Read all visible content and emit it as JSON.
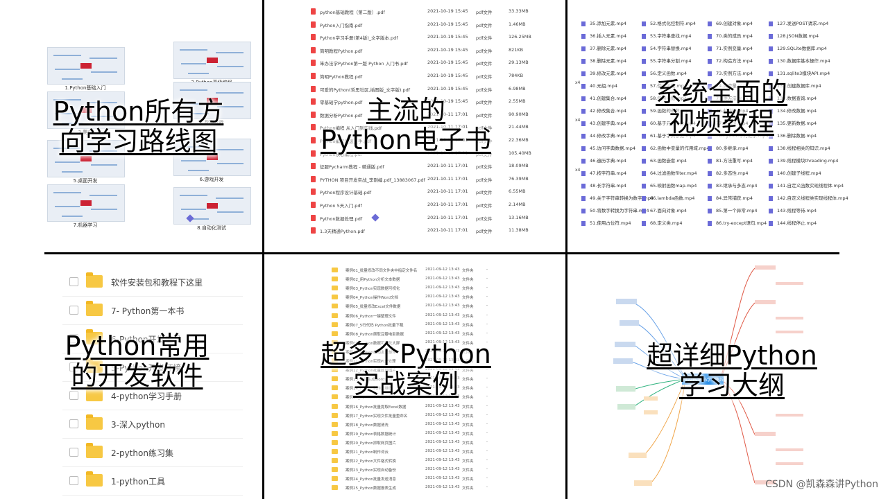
{
  "panels": {
    "roadmap": {
      "title": "Python所有方\n向学习路线图",
      "thumbs": [
        "1.Python基础入门",
        "2.Python高级编程",
        "3.爬虫",
        "4.数据分析",
        "5.桌面开发",
        "6.游戏开发",
        "7.机器学习",
        "8.自动化测试"
      ]
    },
    "ebooks": {
      "title": "主流的\nPython电子书",
      "files": [
        {
          "name": "python基础教程（第二版）.pdf",
          "date": "2021-10-19 15:45",
          "type": "pdf文件",
          "size": "33.33MB"
        },
        {
          "name": "Python入门指南.pdf",
          "date": "2021-10-19 15:45",
          "type": "pdf文件",
          "size": "1.46MB"
        },
        {
          "name": "Python学习手册(第4版)_文字版本.pdf",
          "date": "2021-10-19 15:45",
          "type": "pdf文件",
          "size": "126.25MB"
        },
        {
          "name": "简明教程Python.pdf",
          "date": "2021-10-19 15:45",
          "type": "pdf文件",
          "size": "821KB"
        },
        {
          "name": "笨办法学Python第一版 Python 入门书.pdf",
          "date": "2021-10-19 15:45",
          "type": "pdf文件",
          "size": "29.13MB"
        },
        {
          "name": "简明Python教程.pdf",
          "date": "2021-10-19 15:45",
          "type": "pdf文件",
          "size": "784KB"
        },
        {
          "name": "可爱的Python(哲思社区,插图版_文字版).pdf",
          "date": "2021-10-19 15:45",
          "type": "pdf文件",
          "size": "6.98MB"
        },
        {
          "name": "零基础学python.pdf",
          "date": "2021-10-19 15:45",
          "type": "pdf文件",
          "size": "2.55MB"
        },
        {
          "name": "数据分析Python.pdf",
          "date": "2021-10-11 17:01",
          "type": "pdf文件",
          "size": "90.90MB"
        },
        {
          "name": "Python编程 从入门到实践.pdf",
          "date": "2021-10-11 17:01",
          "type": "pdf文件",
          "size": "21.44MB"
        },
        {
          "name": "Python编程快速上手.pdf",
          "date": "2021-10-11 17:01",
          "type": "pdf文件",
          "size": "22.36MB"
        },
        {
          "name": "Python核心编程.pdf",
          "date": "2021-10-11 17:01",
          "type": "pdf文件",
          "size": "105.40MB"
        },
        {
          "name": "征服Pycharm教程 - 精通版.pdf",
          "date": "2021-10-11 17:01",
          "type": "pdf文件",
          "size": "18.09MB"
        },
        {
          "name": "PYTHON 项目开发实战_李刚编.pdf_13883067.pdf",
          "date": "2021-10-11 17:01",
          "type": "pdf文件",
          "size": "76.39MB"
        },
        {
          "name": "Python程序设计基础.pdf",
          "date": "2021-10-11 17:01",
          "type": "pdf文件",
          "size": "6.55MB"
        },
        {
          "name": "Python 5天入门.pdf",
          "date": "2021-10-11 17:01",
          "type": "pdf文件",
          "size": "2.14MB"
        },
        {
          "name": "Python数据处理.pdf",
          "date": "2021-10-11 17:01",
          "type": "pdf文件",
          "size": "13.16MB"
        },
        {
          "name": "1.3天精通Python.pdf",
          "date": "2021-10-11 17:01",
          "type": "pdf文件",
          "size": "11.38MB"
        }
      ]
    },
    "videos": {
      "title": "系统全面的\n视频教程",
      "markers": [
        "x4",
        "x4",
        "x4"
      ],
      "columns": [
        [
          "35.添加元素.mp4",
          "36.插入元素.mp4",
          "37.删除元素.mp4",
          "38.删除元素.mp4",
          "39.修改元素.mp4",
          "40.元组.mp4",
          "41.创建集合.mp4",
          "42.修改集合.mp4",
          "43.创建字典.mp4",
          "44.修改字典.mp4",
          "45.访问字典数据.mp4",
          "46.遍历字典.mp4",
          "47.按字符串.mp4",
          "48.长字符串.mp4",
          "49.关于字符串转换为数字.mp4",
          "50.将数字转换为字符串.mp4",
          "51.使用占位符.mp4"
        ],
        [
          "52.格式化控制符.mp4",
          "53.字符串查找.mp4",
          "54.字符串替换.mp4",
          "55.字符串分割.mp4",
          "56.定义函数.mp4",
          "57.使用函数.mp4",
          "58.使用函数.mp4",
          "59.函数的参数.mp4",
          "60.基于元组参数.mp4",
          "61.基于字典参数.mp4",
          "62.函数中变量的作用域.mp4",
          "63.函数嵌套.mp4",
          "64.过滤函数filter.mp4",
          "65.映射函数map.mp4",
          "66.lambda函数.mp4",
          "67.面向对象.mp4",
          "68.定义类.mp4"
        ],
        [
          "69.创建对象.mp4",
          "70.类的成员.mp4",
          "71.实例变量.mp4",
          "72.构造方法.mp4",
          "73.实例方法.mp4",
          "74.类变量.mp4",
          "75.类方法.mp4",
          "76.封装性.mp4",
          "77.继承性.mp4",
          "78.Python中的继承.mp4",
          "80.多继承.mp4",
          "81.方法重写.mp4",
          "82.多态性.mp4",
          "83.继承与多态.mp4",
          "84.异常捕获.mp4",
          "85.第一个异常.mp4",
          "86.try-except语句.mp4"
        ],
        [
          "127.发送POST请求.mp4",
          "128.JSON数据.mp4",
          "129.SQLite数据库.mp4",
          "130.数据库基本操作.mp4",
          "131.sqlite3模块API.mp4",
          "132.创建数据库.mp4",
          "133.数据查询.mp4",
          "134.修改数据.mp4",
          "135.更新数据.mp4",
          "136.删除数据.mp4",
          "138.线程相关的知识.mp4",
          "139.线程模块threading.mp4",
          "140.创建子线程.mp4",
          "141.自定义函数实现线程体.mp4",
          "142.自定义线程类实现线程体.mp4",
          "143.线程等待.mp4",
          "144.线程停止.mp4"
        ]
      ]
    },
    "software": {
      "title": "Python常用\n的开发软件",
      "folders": [
        "软件安装包和教程下这里",
        "7- Python第一本书",
        "6-Python开发工具",
        "5-Python开发环境",
        "4-python学习手册",
        "3-深入python",
        "2-python练习集",
        "1-python工具"
      ]
    },
    "cases": {
      "title": "超多个Python\n实战案例",
      "rows": [
        {
          "name": "案例01_批量修改不同文件夹中指定文件名",
          "date": "2021-09-12 13:43",
          "type": "文件夹",
          "extra": "-"
        },
        {
          "name": "案例02_用Python分析文本数据",
          "date": "2021-09-12 13:43",
          "type": "文件夹",
          "extra": "-"
        },
        {
          "name": "案例03_Python实现数据可视化",
          "date": "2021-09-12 13:43",
          "type": "文件夹",
          "extra": "-"
        },
        {
          "name": "案例04_Python操作Word文档",
          "date": "2021-09-12 13:43",
          "type": "文件夹",
          "extra": "-"
        },
        {
          "name": "案例05_批量修改Excel文件数据",
          "date": "2021-09-12 13:43",
          "type": "文件夹",
          "extra": "-"
        },
        {
          "name": "案例06_Python一键整理文件",
          "date": "2021-09-12 13:43",
          "type": "文件夹",
          "extra": "-"
        },
        {
          "name": "案例07_5行代码 Python批量下载",
          "date": "2021-09-12 13:43",
          "type": "文件夹",
          "extra": "-"
        },
        {
          "name": "案例08_Python爬取豆瓣电影数据",
          "date": "2021-09-12 13:43",
          "type": "文件夹",
          "extra": "-"
        },
        {
          "name": "案例09_Python数据可视化大屏",
          "date": "2021-09-12 13:43",
          "type": "文件夹",
          "extra": "-"
        },
        {
          "name": "案例10_Python自动发送邮件",
          "date": "2021-09-12 13:43",
          "type": "文件夹",
          "extra": "-"
        },
        {
          "name": "案例11_Python实现PDF处理",
          "date": "2021-09-12 13:43",
          "type": "文件夹",
          "extra": "-"
        },
        {
          "name": "案例12_Python批量处理图片",
          "date": "2021-09-12 13:43",
          "type": "文件夹",
          "extra": "-"
        },
        {
          "name": "案例13_批量生成word合同",
          "date": "2021-09-12 13:43",
          "type": "文件夹",
          "extra": "-"
        },
        {
          "name": "案例14_Python制作二维码",
          "date": "2021-09-12 13:43",
          "type": "文件夹",
          "extra": "-"
        },
        {
          "name": "案例15_Python自动化办公",
          "date": "2021-09-12 13:43",
          "type": "文件夹",
          "extra": "-"
        },
        {
          "name": "案例16_Python批量提取Excel数据",
          "date": "2021-09-12 13:43",
          "type": "文件夹",
          "extra": "-"
        },
        {
          "name": "案例17_Python实现文件批量重命名",
          "date": "2021-09-12 13:43",
          "type": "文件夹",
          "extra": "-"
        },
        {
          "name": "案例18_Python数据清洗",
          "date": "2021-09-12 13:43",
          "type": "文件夹",
          "extra": "-"
        },
        {
          "name": "案例19_Python表格数据统计",
          "date": "2021-09-12 13:43",
          "type": "文件夹",
          "extra": "-"
        },
        {
          "name": "案例20_Python抓取网页图片",
          "date": "2021-09-12 13:43",
          "type": "文件夹",
          "extra": "-"
        },
        {
          "name": "案例21_Python制作词云",
          "date": "2021-09-12 13:43",
          "type": "文件夹",
          "extra": "-"
        },
        {
          "name": "案例22_Python文件格式转换",
          "date": "2021-09-12 13:43",
          "type": "文件夹",
          "extra": "-"
        },
        {
          "name": "案例23_Python实现自动备份",
          "date": "2021-09-12 13:43",
          "type": "文件夹",
          "extra": "-"
        },
        {
          "name": "案例24_Python批量发送消息",
          "date": "2021-09-12 13:43",
          "type": "文件夹",
          "extra": "-"
        },
        {
          "name": "案例25_Python数据报表生成",
          "date": "2021-09-12 13:43",
          "type": "文件夹",
          "extra": "-"
        }
      ]
    },
    "outline": {
      "title": "超详细Python\n学习大纲",
      "center_label": "2022Python学习路线"
    }
  },
  "watermark": "CSDN @凯森森讲Python",
  "colors": {
    "divider": "#000000",
    "folder": "#f7c843",
    "pdf_icon": "#e44444",
    "video_icon": "#6a6ad8",
    "mind_center": "#1e88e5"
  }
}
